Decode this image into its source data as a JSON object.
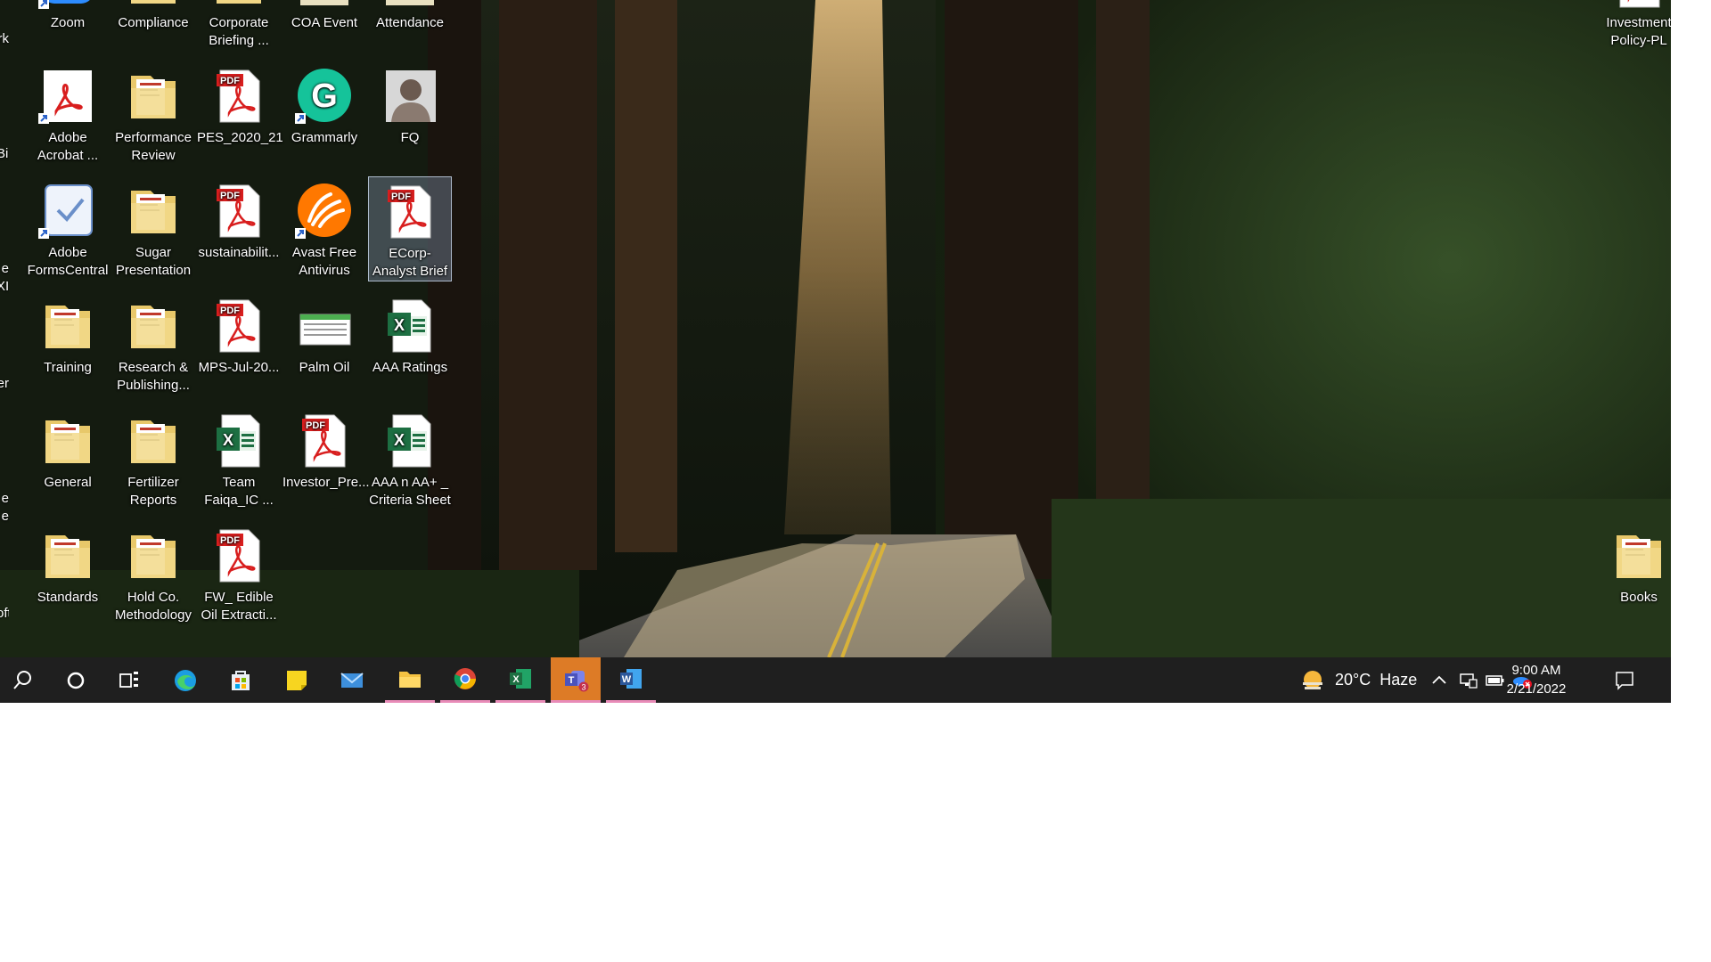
{
  "desktop": {
    "icons": [
      {
        "label": "Zoom",
        "icon": "zoom-icon"
      },
      {
        "label": "Compliance",
        "icon": "folder-icon"
      },
      {
        "label": "Corporate Briefing ...",
        "icon": "folder-icon"
      },
      {
        "label": "COA Event",
        "icon": "image-icon"
      },
      {
        "label": "Attendance",
        "icon": "image-icon"
      },
      {
        "label": "Adobe Acrobat ...",
        "icon": "acrobat-icon"
      },
      {
        "label": "Performance Review",
        "icon": "folder-icon"
      },
      {
        "label": "PES_2020_21",
        "icon": "pdf-icon"
      },
      {
        "label": "Grammarly",
        "icon": "grammarly-icon"
      },
      {
        "label": "FQ",
        "icon": "photo-icon"
      },
      {
        "label": "Adobe FormsCentral",
        "icon": "formscentral-icon"
      },
      {
        "label": "Sugar Presentation",
        "icon": "folder-icon"
      },
      {
        "label": "sustainabilit...",
        "icon": "pdf-icon"
      },
      {
        "label": "Avast Free Antivirus",
        "icon": "avast-icon"
      },
      {
        "label": "ECorp-Analyst Brief",
        "icon": "pdf-icon"
      },
      {
        "label": "Training",
        "icon": "folder-icon"
      },
      {
        "label": "Research & Publishing...",
        "icon": "folder-icon"
      },
      {
        "label": "MPS-Jul-20...",
        "icon": "pdf-icon"
      },
      {
        "label": "Palm Oil",
        "icon": "palm-oil-icon"
      },
      {
        "label": "AAA Ratings",
        "icon": "excel-file-icon"
      },
      {
        "label": "General",
        "icon": "folder-icon"
      },
      {
        "label": "Fertilizer Reports",
        "icon": "folder-icon"
      },
      {
        "label": "Team Faiqa_IC ...",
        "icon": "excel-file-icon"
      },
      {
        "label": "Investor_Pre...",
        "icon": "pdf-icon"
      },
      {
        "label": "AAA n AA+ _ Criteria Sheet",
        "icon": "excel-file-icon"
      },
      {
        "label": "Standards",
        "icon": "folder-icon"
      },
      {
        "label": "Hold Co. Methodology",
        "icon": "folder-icon"
      },
      {
        "label": "FW_ Edible Oil Extracti...",
        "icon": "pdf-icon"
      },
      {
        "label": "Investment Policy-PL",
        "icon": "pdf-icon"
      },
      {
        "label": "Books",
        "icon": "folder-icon"
      }
    ],
    "partial_labels": [
      "rk",
      "Bin",
      "e XI",
      "er",
      "e e",
      "oft"
    ],
    "pdf_badge": "PDF",
    "excel_glyph": "X",
    "grammarly_glyph": "G"
  },
  "taskbar": {
    "items": [
      {
        "name": "search",
        "icon": "search-icon"
      },
      {
        "name": "cortana",
        "icon": "cortana-icon"
      },
      {
        "name": "task-view",
        "icon": "task-view-icon"
      },
      {
        "name": "edge",
        "icon": "edge-icon"
      },
      {
        "name": "store",
        "icon": "store-icon"
      },
      {
        "name": "sticky-notes",
        "icon": "sticky-notes-icon"
      },
      {
        "name": "mail",
        "icon": "mail-icon"
      },
      {
        "name": "file-explorer",
        "icon": "folder-icon"
      },
      {
        "name": "chrome",
        "icon": "chrome-icon"
      },
      {
        "name": "excel",
        "icon": "excel-icon"
      },
      {
        "name": "teams",
        "icon": "teams-icon"
      },
      {
        "name": "word",
        "icon": "word-icon"
      }
    ],
    "teams_badge": "3",
    "excel_letter": "X",
    "word_letter": "W",
    "teams_letter": "T"
  },
  "tray": {
    "temperature": "20°C",
    "condition": "Haze",
    "time": "9:00 AM",
    "date": "2/21/2022"
  },
  "colors": {
    "taskbar": "#1f1f1f",
    "accent_running": "#e88bb8",
    "teams_active": "#ff8a1a",
    "pdf_red": "#d81e1e",
    "excel_green": "#1d6f42",
    "word_blue": "#2b579a",
    "grammarly_green": "#15c39a",
    "avast_orange": "#ff7800",
    "zoom_blue": "#2d8cff"
  }
}
